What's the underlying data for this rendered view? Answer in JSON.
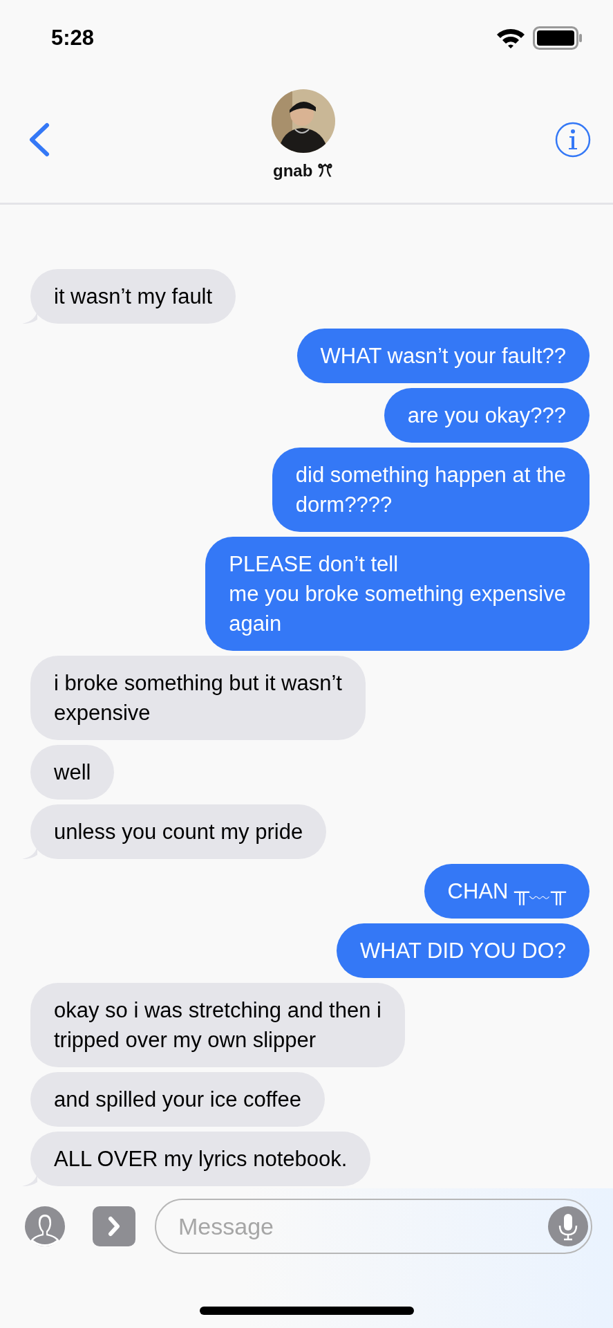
{
  "status_bar": {
    "time": "5:28"
  },
  "contact": {
    "name": "gnab ꔫ"
  },
  "messages": [
    {
      "kind": "received",
      "text": "it wasn’t my fault",
      "tail": true
    },
    {
      "kind": "sent",
      "text": "WHAT wasn’t your fault??",
      "tail": false
    },
    {
      "kind": "sent",
      "text": "are you okay???",
      "tail": false
    },
    {
      "kind": "sent",
      "text": "did something happen at the\ndorm????",
      "tail": false
    },
    {
      "kind": "sent",
      "text": "PLEASE don’t tell\nme you broke something expensive\nagain",
      "tail": false
    },
    {
      "kind": "received",
      "text": "i broke something but it wasn’t\nexpensive",
      "tail": false
    },
    {
      "kind": "received",
      "text": "well",
      "tail": false
    },
    {
      "kind": "received",
      "text": "unless you count my pride",
      "tail": true
    },
    {
      "kind": "sent",
      "text": "CHAN ╥﹏╥",
      "tail": false
    },
    {
      "kind": "sent",
      "text": "WHAT DID YOU DO?",
      "tail": false
    },
    {
      "kind": "received",
      "text": "okay so i was stretching and then i\ntripped over my own slipper",
      "tail": false
    },
    {
      "kind": "received",
      "text": "and spilled your ice coffee",
      "tail": false
    },
    {
      "kind": "received",
      "text": "ALL OVER my lyrics notebook.",
      "tail": true
    }
  ],
  "composer": {
    "placeholder": "Message"
  }
}
